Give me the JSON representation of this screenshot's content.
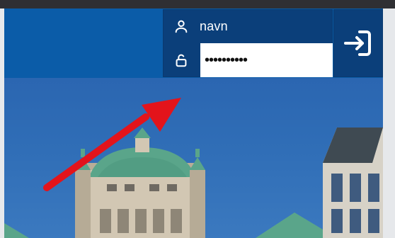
{
  "login": {
    "username_value": "navn",
    "password_value": "••••••••••"
  },
  "icons": {
    "user": "user-icon",
    "lock": "unlock-icon",
    "login": "login-arrow-icon",
    "annotation": "red-arrow-annotation"
  },
  "colors": {
    "header_blue": "#0b5ca8",
    "login_dark_blue": "#0b3f7a",
    "arrow_red": "#e3141b",
    "sky": "#2f6db6",
    "copper": "#5aa58a"
  }
}
